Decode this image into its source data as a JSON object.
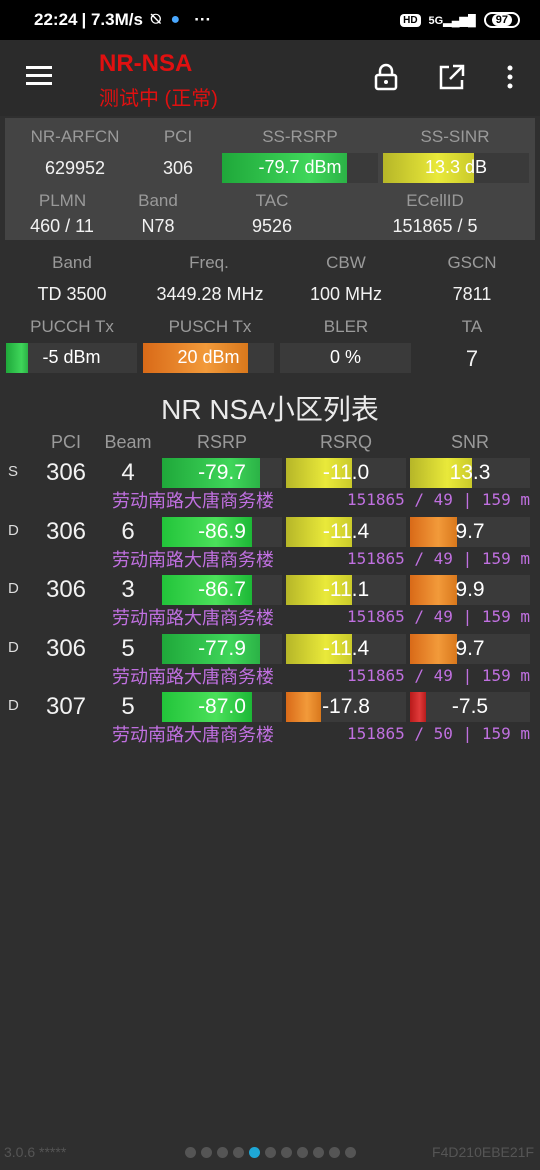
{
  "status": {
    "time": "22:24",
    "speed": "| 7.3M/s",
    "hd": "HD",
    "net": "5G",
    "battery": "97"
  },
  "app": {
    "title": "NR-NSA",
    "subtitle": "测试中 (正常)"
  },
  "serving": {
    "labels1": [
      "NR-ARFCN",
      "PCI",
      "SS-RSRP",
      "SS-SINR"
    ],
    "arfcn": "629952",
    "pci": "306",
    "rsrp": "-79.7 dBm",
    "sinr": "13.3 dB",
    "labels2": [
      "PLMN",
      "Band",
      "TAC",
      "ECellID"
    ],
    "plmn": "460 / 11",
    "band": "N78",
    "tac": "9526",
    "ecellid": "151865 / 5"
  },
  "radio": {
    "labels1": [
      "Band",
      "Freq.",
      "CBW",
      "GSCN"
    ],
    "band": "TD 3500",
    "freq": "3449.28 MHz",
    "cbw": "100 MHz",
    "gscn": "7811",
    "labels2": [
      "PUCCH Tx",
      "PUSCH Tx",
      "BLER",
      "TA"
    ],
    "pucch": "-5 dBm",
    "pusch": "20 dBm",
    "bler": "0 %",
    "ta": "7"
  },
  "list": {
    "title": "NR NSA小区列表",
    "headers": [
      "PCI",
      "Beam",
      "RSRP",
      "RSRQ",
      "SNR"
    ],
    "rows": [
      {
        "type": "S",
        "pci": "306",
        "beam": "4",
        "rsrp": "-79.7",
        "rsrq": "-11.0",
        "snr": "13.3",
        "name": "劳动南路大唐商务楼",
        "info": "151865 / 49 | 159 m"
      },
      {
        "type": "D",
        "pci": "306",
        "beam": "6",
        "rsrp": "-86.9",
        "rsrq": "-11.4",
        "snr": "9.7",
        "name": "劳动南路大唐商务楼",
        "info": "151865 / 49 | 159 m"
      },
      {
        "type": "D",
        "pci": "306",
        "beam": "3",
        "rsrp": "-86.7",
        "rsrq": "-11.1",
        "snr": "9.9",
        "name": "劳动南路大唐商务楼",
        "info": "151865 / 49 | 159 m"
      },
      {
        "type": "D",
        "pci": "306",
        "beam": "5",
        "rsrp": "-77.9",
        "rsrq": "-11.4",
        "snr": "9.7",
        "name": "劳动南路大唐商务楼",
        "info": "151865 / 49 | 159 m"
      },
      {
        "type": "D",
        "pci": "307",
        "beam": "5",
        "rsrp": "-87.0",
        "rsrq": "-17.8",
        "snr": "-7.5",
        "name": "劳动南路大唐商务楼",
        "info": "151865 / 50 | 159 m"
      }
    ]
  },
  "footer": {
    "version": "3.0.6 *****",
    "device": "F4D210EBE21F",
    "page_count": 11,
    "active_page": 4
  }
}
